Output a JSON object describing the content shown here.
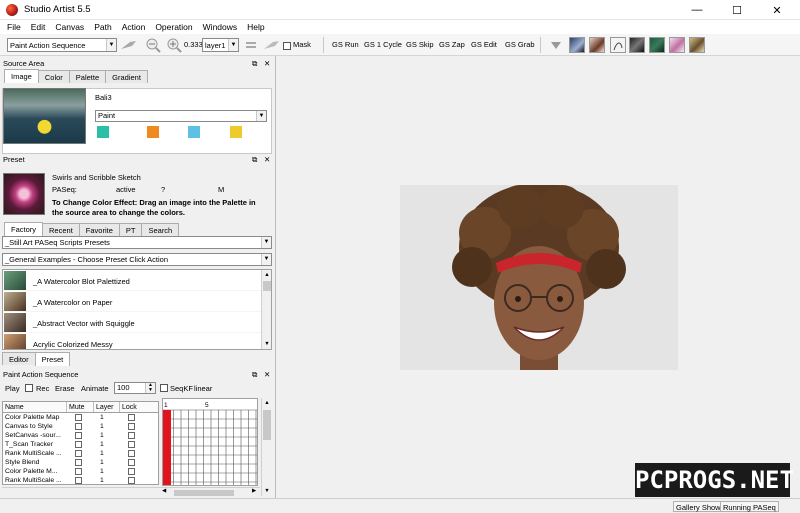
{
  "window": {
    "title": "Studio Artist 5.5",
    "controls": {
      "minimize": "—",
      "maximize": "☐",
      "close": "✕"
    }
  },
  "menu": [
    "File",
    "Edit",
    "Canvas",
    "Path",
    "Action",
    "Operation",
    "Windows",
    "Help"
  ],
  "toolbar": {
    "mode_select": "Paint Action Sequence",
    "zoom_value": "0.333",
    "layer_select": "layer1",
    "mask_label": "Mask",
    "gs_buttons": [
      "GS Run",
      "GS 1 Cycle",
      "GS Skip",
      "GS Zap",
      "GS Edit",
      "GS Grab"
    ]
  },
  "source_area": {
    "header": "Source Area",
    "tabs": [
      "Image",
      "Color",
      "Palette",
      "Gradient"
    ],
    "active_tab": "Image",
    "image_name": "Bali3",
    "paint_select": "Paint",
    "swatches": [
      "#2bbfa8",
      "#ef8a1f",
      "#5fc0e6",
      "#f0c92a"
    ]
  },
  "preset": {
    "header": "Preset",
    "name": "Swirls and Scribble Sketch",
    "paseq_label": "PASeq:",
    "paseq_status": "active",
    "paseq_q": "?",
    "paseq_m": "M",
    "hint": "To Change Color Effect: Drag an image into the Palette in the source area to change the colors.",
    "tabs": [
      "Factory",
      "Recent",
      "Favorite",
      "PT",
      "Search"
    ],
    "active_tab": "Factory",
    "category_select": "_Still Art PASeq Scripts Presets",
    "group_select": "_General Examples - Choose Preset Click Action",
    "items": [
      "_A Watercolor Blot Palettized",
      "_A Watercolor on Paper",
      "_Abstract Vector with Squiggle",
      "Acrylic Colorized Messy"
    ],
    "bottom_tabs": [
      "Editor",
      "Preset"
    ],
    "active_bottom_tab": "Preset"
  },
  "pas": {
    "header": "Paint Action Sequence",
    "play_label": "Play",
    "rec_label": "Rec",
    "erase_label": "Erase",
    "animate_label": "Animate",
    "animate_value": "100",
    "seqkf_label": "SeqKF",
    "linear_label": "linear",
    "columns": [
      "Name",
      "Mute",
      "Layer",
      "Lock"
    ],
    "rows": [
      {
        "name": "Color Palette Map",
        "layer": "1"
      },
      {
        "name": "Canvas to Style",
        "layer": "1"
      },
      {
        "name": "SetCanvas -sour...",
        "layer": "1"
      },
      {
        "name": "T_Scan Tracker",
        "layer": "1"
      },
      {
        "name": "Rank MultiScale ...",
        "layer": "1"
      },
      {
        "name": "Style Blend",
        "layer": "1"
      },
      {
        "name": "Color Palette M...",
        "layer": "1"
      },
      {
        "name": "Rank MultiScale ...",
        "layer": "1"
      }
    ],
    "timeline_start": "1",
    "timeline_mark": "5"
  },
  "watermark": "PCPROGS.NET",
  "status": {
    "gallery": "Gallery Show",
    "running": "Running PASeq"
  }
}
